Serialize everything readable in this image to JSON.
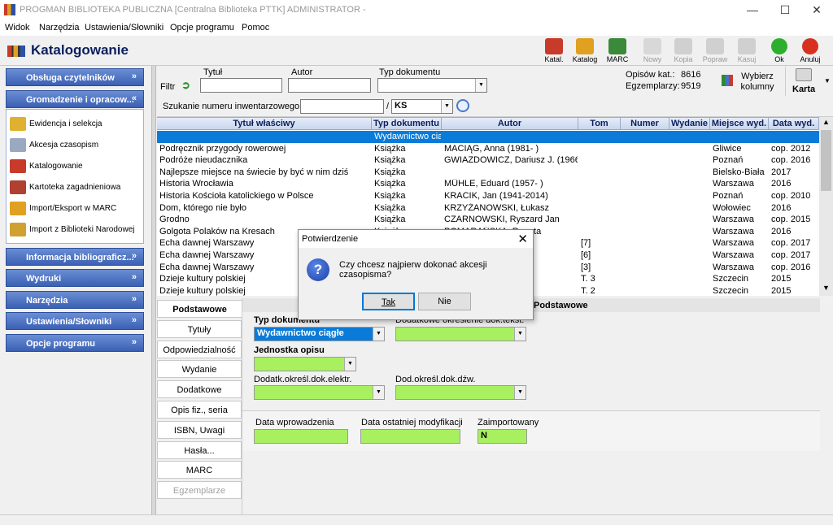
{
  "window": {
    "title": "PROGMAN BIBLIOTEKA PUBLICZNA [Centralna Biblioteka PTTK] ADMINISTRATOR -"
  },
  "menu": [
    "Widok",
    "Narzędzia",
    "Ustawienia/Słowniki",
    "Opcje programu",
    "Pomoc"
  ],
  "module": {
    "title": "Katalogowanie",
    "toolbar": [
      {
        "label": "Katal.",
        "icon": "books-icon",
        "color": "#c83a2a",
        "enabled": true
      },
      {
        "label": "Katalog",
        "icon": "catalog-icon",
        "color": "#e0a020",
        "enabled": true
      },
      {
        "label": "MARC",
        "icon": "marc-icon",
        "color": "#3a8a3a",
        "enabled": true
      },
      {
        "label": "Nowy",
        "icon": "new-document-icon",
        "color": "#d8d8d8",
        "enabled": false
      },
      {
        "label": "Kopia",
        "icon": "copy-icon",
        "color": "#d0d0d0",
        "enabled": false
      },
      {
        "label": "Popraw",
        "icon": "edit-icon",
        "color": "#d0d0d0",
        "enabled": false
      },
      {
        "label": "Kasuj",
        "icon": "trash-icon",
        "color": "#d0d0d0",
        "enabled": false
      },
      {
        "label": "Ok",
        "icon": "ok-icon",
        "color": "#2eae2e",
        "enabled": true
      },
      {
        "label": "Anuluj",
        "icon": "cancel-icon",
        "color": "#d83020",
        "enabled": true
      }
    ]
  },
  "sidebar": {
    "sections_top": [
      {
        "label": "Obsługa czytelników",
        "chev": "»"
      },
      {
        "label": "Gromadzenie i opracow...",
        "chev": "«"
      }
    ],
    "subitems": [
      {
        "label": "Ewidencja i selekcja",
        "icon": "folder-icon",
        "color": "#e0b030"
      },
      {
        "label": "Akcesja czasopism",
        "icon": "journal-icon",
        "color": "#9aa8c0"
      },
      {
        "label": "Katalogowanie",
        "icon": "books-icon",
        "color": "#c83a2a"
      },
      {
        "label": "Kartoteka zagadnieniowa",
        "icon": "card-index-icon",
        "color": "#b04030"
      },
      {
        "label": "Import/Eksport w MARC",
        "icon": "marc-icon",
        "color": "#e0a020"
      },
      {
        "label": "Import z Biblioteki Narodowej",
        "icon": "import-bn-icon",
        "color": "#d0a030"
      }
    ],
    "sections_bottom": [
      {
        "label": "Informacja bibliograficz...",
        "chev": "»"
      },
      {
        "label": "Wydruki",
        "chev": "»"
      },
      {
        "label": "Narzędzia",
        "chev": "»"
      },
      {
        "label": "Ustawienia/Słowniki",
        "chev": "»"
      },
      {
        "label": "Opcje programu",
        "chev": "»"
      }
    ]
  },
  "filter": {
    "label": "Filtr",
    "title_label": "Tytuł",
    "title_value": "",
    "author_label": "Autor",
    "author_value": "",
    "doctype_label": "Typ dokumentu",
    "doctype_value": "",
    "inv_label": "Szukanie numeru inwentarzowego",
    "inv_value": "",
    "inv_sep": "/",
    "inv_suffix": "KS",
    "opisow_label": "Opisów kat.:",
    "opisow_value": "8616",
    "egz_label": "Egzemplarzy:",
    "egz_value": "9519",
    "columns_btn": "Wybierz kolumny",
    "karta_btn": "Karta"
  },
  "grid": {
    "columns": [
      "Tytuł właściwy",
      "Typ dokumentu",
      "Autor",
      "Tom",
      "Numer",
      "Wydanie",
      "Miejsce wyd.",
      "Data wyd."
    ],
    "rows": [
      [
        "",
        "Wydawnictwo ciąg",
        "",
        "",
        "",
        "",
        "",
        ""
      ],
      [
        "Podręcznik przygody rowerowej",
        "Książka",
        "MACIĄG, Anna (1981- )",
        "",
        "",
        "",
        "Gliwice",
        "cop. 2012"
      ],
      [
        "Podróże nieudacznika",
        "Książka",
        "GWIAZDOWICZ, Dariusz J. (1966- )",
        "",
        "",
        "",
        "Poznań",
        "cop. 2016"
      ],
      [
        "Najlepsze miejsce na świecie by być w nim dziś",
        "Książka",
        "",
        "",
        "",
        "",
        "Bielsko-Biała",
        "2017"
      ],
      [
        "Historia Wrocławia",
        "Książka",
        "MÜHLE, Eduard (1957- )",
        "",
        "",
        "",
        "Warszawa",
        "2016"
      ],
      [
        "Historia Kościoła katolickiego w Polsce",
        "Książka",
        "KRACIK, Jan (1941-2014)",
        "",
        "",
        "",
        "Poznań",
        "cop. 2010"
      ],
      [
        "Dom, którego nie było",
        "Książka",
        "KRZYŻANOWSKI, Łukasz",
        "",
        "",
        "",
        "Wołowiec",
        "2016"
      ],
      [
        "Grodno",
        "Książka",
        "CZARNOWSKI, Ryszard Jan",
        "",
        "",
        "",
        "Warszawa",
        "cop. 2015"
      ],
      [
        "Golgota Polaków na Kresach",
        "Książka",
        "POMARAŃSKA, Renata",
        "",
        "",
        "",
        "Warszawa",
        "2016"
      ],
      [
        "Echa dawnej Warszawy",
        "",
        "",
        "[7]",
        "",
        "",
        "Warszawa",
        "cop. 2017"
      ],
      [
        "Echa dawnej Warszawy",
        "",
        "",
        "[6]",
        "",
        "",
        "Warszawa",
        "cop. 2017"
      ],
      [
        "Echa dawnej Warszawy",
        "",
        "",
        "[3]",
        "",
        "",
        "Warszawa",
        "cop. 2016"
      ],
      [
        "Dzieje kultury polskiej",
        "",
        "er (1856-19",
        "T. 3",
        "",
        "",
        "Szczecin",
        "2015"
      ],
      [
        "Dzieje kultury polskiej",
        "",
        "er (1856-19",
        "T. 2",
        "",
        "",
        "Szczecin",
        "2015"
      ]
    ]
  },
  "tabs": [
    "Podstawowe",
    "Tytuły",
    "Odpowiedzialność",
    "Wydanie",
    "Dodatkowe",
    "Opis fiz., seria",
    "ISBN, Uwagi",
    "Hasła...",
    "MARC",
    "Egzemplarze"
  ],
  "detail": {
    "header": "Podstawowe",
    "doctype_label": "Typ dokumentu",
    "doctype_value": "Wydawnictwo ciągłe",
    "dodatkowe_label": "Dodatkowe określenie dok.tekst.",
    "dodatkowe_value": "",
    "jednostka_label": "Jednostka opisu",
    "jednostka_value": "",
    "elektr_label": "Dodatk.określ.dok.elektr.",
    "elektr_value": "",
    "dzw_label": "Dod.określ.dok.dźw.",
    "dzw_value": "",
    "data_wpr_label": "Data wprowadzenia",
    "data_wpr_value": "",
    "data_mod_label": "Data ostatniej modyfikacji",
    "data_mod_value": "",
    "zaimp_label": "Zaimportowany",
    "zaimp_value": "N"
  },
  "dialog": {
    "title": "Potwierdzenie",
    "message": "Czy chcesz najpierw dokonać akcesji czasopisma?",
    "yes": "Tak",
    "no": "Nie"
  },
  "colors": {
    "accent": "#0a7bd8",
    "field_green": "#a8f060",
    "nav_blue": "#3b60b4"
  }
}
